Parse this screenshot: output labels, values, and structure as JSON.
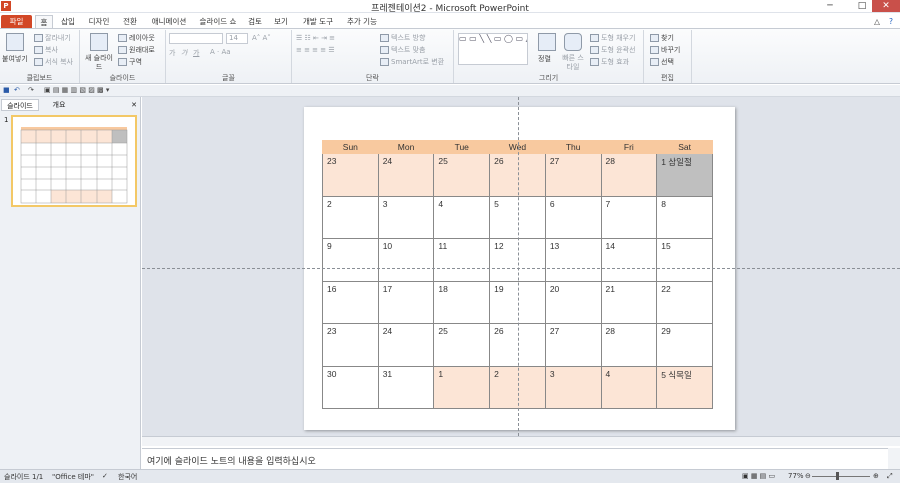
{
  "window": {
    "title": "프레젠테이션2 - Microsoft PowerPoint",
    "app_icon": "P",
    "min": "─",
    "max": "□",
    "close": "✕"
  },
  "tabs": [
    "파일",
    "홈",
    "삽입",
    "디자인",
    "전환",
    "애니메이션",
    "슬라이드 쇼",
    "검토",
    "보기",
    "개발 도구",
    "추가 기능"
  ],
  "ribbon": {
    "clipboard": {
      "label": "클립보드",
      "paste": "붙여넣기",
      "cut": "잘라내기",
      "copy": "복사",
      "format_painter": "서식 복사"
    },
    "slides": {
      "label": "슬라이드",
      "new_slide": "새 슬라이드",
      "layout": "레이아웃",
      "reset": "원래대로",
      "section": "구역"
    },
    "font": {
      "label": "글꼴",
      "size": "14",
      "bold": "가",
      "italic": "가",
      "underline": "가"
    },
    "paragraph": {
      "label": "단락",
      "text_direction": "텍스트 방향",
      "align_text": "텍스트 맞춤",
      "smartart": "SmartArt로 변환"
    },
    "drawing": {
      "label": "그리기",
      "arrange": "정렬",
      "quick_styles": "빠른 스타일",
      "shape_fill": "도형 채우기",
      "shape_outline": "도형 윤곽선",
      "shape_effects": "도형 효과"
    },
    "editing": {
      "label": "편집",
      "find": "찾기",
      "replace": "바꾸기",
      "select": "선택"
    }
  },
  "left_pane": {
    "tab_slides": "슬라이드",
    "tab_outline": "개요",
    "close": "✕",
    "slide_number": "1"
  },
  "calendar": {
    "headers": [
      "Sun",
      "Mon",
      "Tue",
      "Wed",
      "Thu",
      "Fri",
      "Sat"
    ],
    "rows": [
      [
        "23",
        "24",
        "25",
        "26",
        "27",
        "28",
        "1 삼일절"
      ],
      [
        "2",
        "3",
        "4",
        "5",
        "6",
        "7",
        "8"
      ],
      [
        "9",
        "10",
        "11",
        "12",
        "13",
        "14",
        "15"
      ],
      [
        "16",
        "17",
        "18",
        "19",
        "20",
        "21",
        "22"
      ],
      [
        "23",
        "24",
        "25",
        "26",
        "27",
        "28",
        "29"
      ],
      [
        "30",
        "31",
        "1",
        "2",
        "3",
        "4",
        "5 식목일"
      ]
    ],
    "header_color": "#f8c99f",
    "outside_month_color": "#fce5d6",
    "holiday_color": "#bfbfbf"
  },
  "notes": {
    "placeholder": "여기에 슬라이드 노트의 내용을 입력하십시오"
  },
  "status": {
    "slide_info": "슬라이드 1/1",
    "theme": "\"Office 테마\"",
    "language": "한국어",
    "zoom": "77%"
  }
}
